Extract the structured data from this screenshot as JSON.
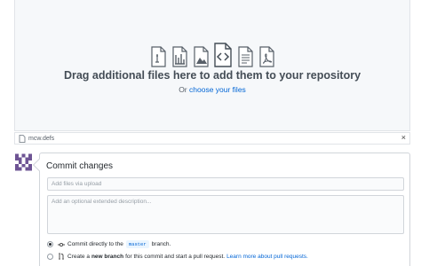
{
  "dropzone": {
    "icons": [
      "file-text-icon",
      "file-chart-icon",
      "file-media-icon",
      "file-code-icon",
      "file-document-icon",
      "file-pdf-icon"
    ],
    "title": "Drag additional files here to add them to your repository",
    "or_text": "Or",
    "choose_link": "choose your files"
  },
  "file_row": {
    "filename": "mcw.defs",
    "close_label": "×"
  },
  "commit": {
    "title": "Commit changes",
    "summary_placeholder": "Add files via upload",
    "description_placeholder": "Add an optional extended description...",
    "option_direct": {
      "prefix": "Commit directly to the",
      "branch": "master",
      "suffix": "branch."
    },
    "option_new": {
      "prefix": "Create a",
      "bold": "new branch",
      "suffix": "for this commit and start a pull request.",
      "link": "Learn more about pull requests."
    }
  },
  "colors": {
    "link": "#0366d6",
    "avatar": "#6e5494"
  }
}
